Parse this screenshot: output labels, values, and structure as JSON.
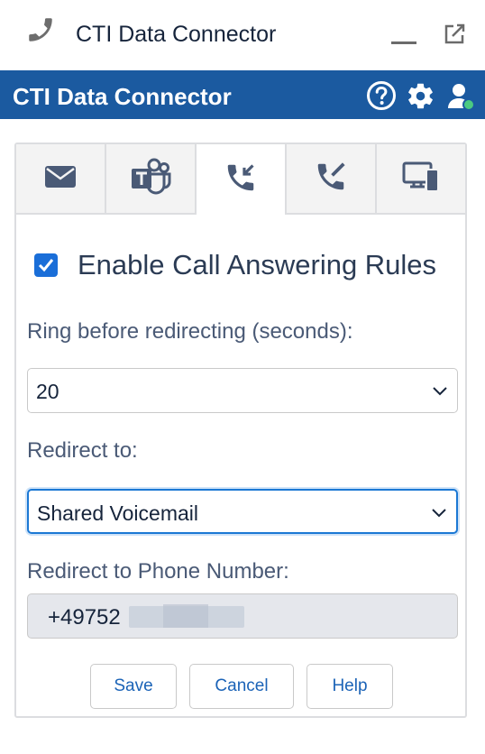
{
  "window": {
    "title": "CTI Data Connector"
  },
  "header": {
    "title": "CTI Data Connector"
  },
  "tabs": [
    {
      "icon": "mail-icon"
    },
    {
      "icon": "teams-icon"
    },
    {
      "icon": "incoming-call-icon",
      "active": true
    },
    {
      "icon": "call-forward-icon"
    },
    {
      "icon": "desktop-device-icon"
    }
  ],
  "settings": {
    "enable_label": "Enable Call Answering Rules",
    "enable_checked": true,
    "ring_label": "Ring before redirecting (seconds):",
    "ring_value": "20",
    "redirect_label": "Redirect to:",
    "redirect_value": "Shared Voicemail",
    "phone_label": "Redirect to Phone Number:",
    "phone_value": "+49752"
  },
  "buttons": {
    "save": "Save",
    "cancel": "Cancel",
    "help": "Help"
  },
  "colors": {
    "header_bg": "#1b5aa0",
    "accent": "#1a6ed8",
    "status_online": "#4bca81"
  }
}
